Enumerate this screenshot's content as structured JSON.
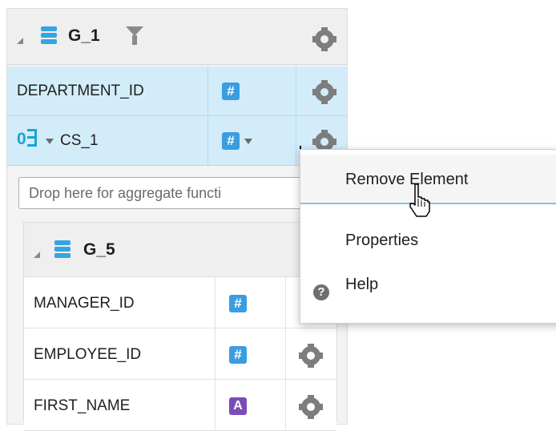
{
  "group_g1": {
    "title": "G_1",
    "rows": [
      {
        "label": "DEPARTMENT_ID",
        "type_icon": "hash-icon"
      },
      {
        "label": "CS_1",
        "type_icon": "hash-icon",
        "row_icon": "summary-formula-icon",
        "row_icon_text": "0"
      }
    ],
    "drop_zone": "Drop here for aggregate functi"
  },
  "group_g5": {
    "title": "G_5",
    "rows": [
      {
        "label": "MANAGER_ID",
        "type_icon": "hash-icon"
      },
      {
        "label": "EMPLOYEE_ID",
        "type_icon": "hash-icon"
      },
      {
        "label": "FIRST_NAME",
        "type_icon": "text-type-icon"
      }
    ]
  },
  "badges": {
    "hash": "#",
    "text": "A",
    "help": "?"
  },
  "context_menu": {
    "items": [
      {
        "label": "Remove Element"
      },
      {
        "label": "Properties"
      },
      {
        "label": "Help"
      }
    ]
  },
  "colors": {
    "selected_row": "#d3ecf9",
    "hash_badge": "#3a9de0",
    "text_badge": "#7b4bb7",
    "database_icon": "#35a5e0",
    "menu_hover_underline": "#7ec3ef"
  }
}
